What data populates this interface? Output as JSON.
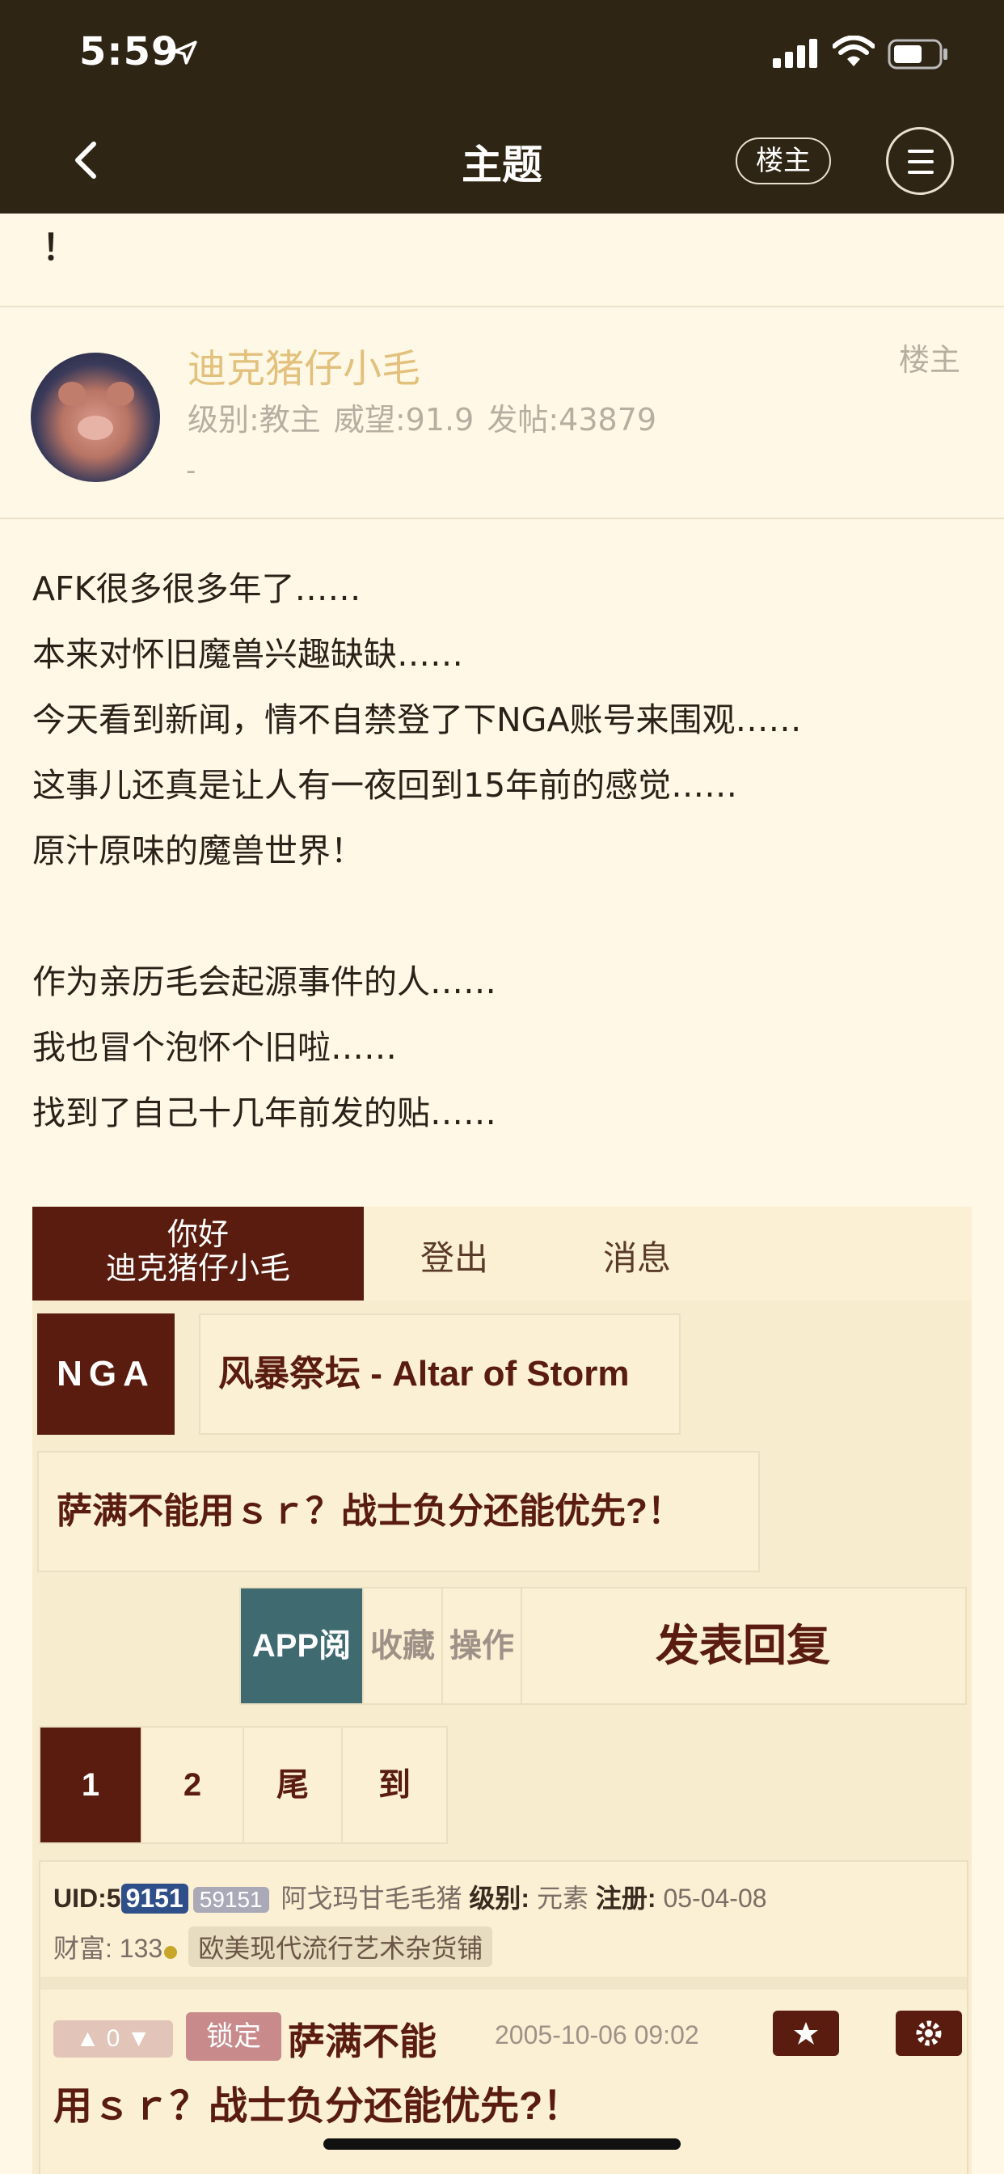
{
  "status_bar": {
    "time": "5:59"
  },
  "nav": {
    "title": "主题",
    "op_button": "楼主"
  },
  "top_fragment": "！",
  "author": {
    "name": "迪克猪仔小毛",
    "meta": "级别:教主  威望:91.9  发帖:43879",
    "extra": "-",
    "tag": "楼主"
  },
  "post_lines": [
    "AFK很多很多年了……",
    "本来对怀旧魔兽兴趣缺缺……",
    "今天看到新闻，情不自禁登了下NGA账号来围观……",
    "这事儿还真是让人有一夜回到15年前的感觉……",
    "原汁原味的魔兽世界！",
    "",
    "作为亲历毛会起源事件的人……",
    "我也冒个泡怀个旧啦……",
    "找到了自己十几年前发的贴……"
  ],
  "screenshot": {
    "greet_line1": "你好",
    "greet_line2": "迪克猪仔小毛",
    "tab_logout": "登出",
    "tab_messages": "消息",
    "logo": "NGA",
    "forum": "风暴祭坛 - Altar of Storm",
    "thread_title": "萨满不能用ｓｒ？战士负分还能优先?！",
    "actions": {
      "app": "APP阅读",
      "fav": "收藏",
      "op": "操作",
      "reply": "发表回复"
    },
    "pages": [
      "1",
      "2",
      "尾",
      "到"
    ],
    "user": {
      "uid_label": "UID:5",
      "uid_highlight": "9151",
      "uid_gray": "59151",
      "username": "阿戈玛甘毛毛猪",
      "level_label": "级别:",
      "level": "元素",
      "reg_label": "注册:",
      "reg": "05-04-08",
      "wealth": "财富: 133",
      "shop": "欧美现代流行艺术杂货铺"
    },
    "post": {
      "votes": "0",
      "lock": "锁定",
      "title_part1": "萨满不能",
      "date": "2005-10-06 09:02",
      "title_part2": "用ｓｒ？战士负分还能优先?！"
    }
  }
}
